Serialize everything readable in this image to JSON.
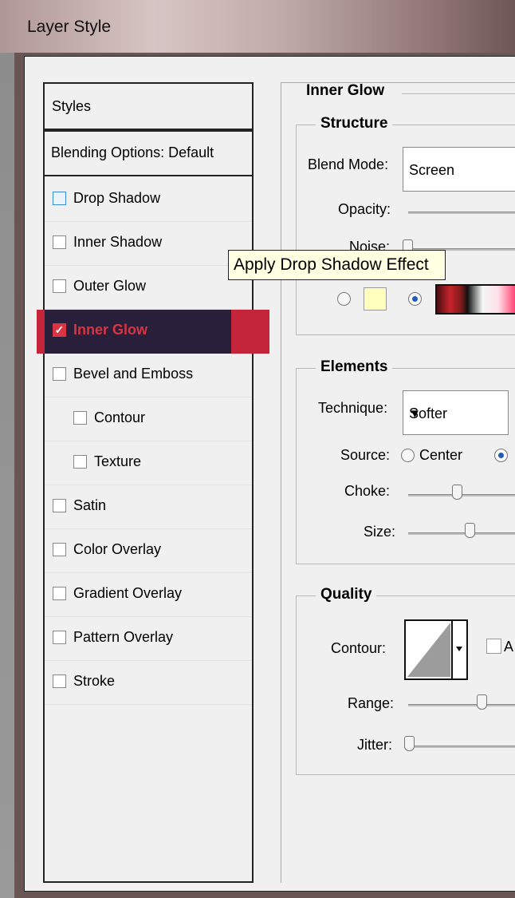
{
  "window": {
    "title": "Layer Style"
  },
  "styles_panel": {
    "header": "Styles",
    "blending_options": "Blending Options: Default",
    "items": [
      {
        "label": "Drop Shadow",
        "checked": false,
        "indent": false,
        "focused": true
      },
      {
        "label": "Inner Shadow",
        "checked": false,
        "indent": false
      },
      {
        "label": "Outer Glow",
        "checked": false,
        "indent": false
      },
      {
        "label": "Inner Glow",
        "checked": true,
        "indent": false,
        "active": true
      },
      {
        "label": "Bevel and Emboss",
        "checked": false,
        "indent": false
      },
      {
        "label": "Contour",
        "checked": false,
        "indent": true
      },
      {
        "label": "Texture",
        "checked": false,
        "indent": true
      },
      {
        "label": "Satin",
        "checked": false,
        "indent": false
      },
      {
        "label": "Color Overlay",
        "checked": false,
        "indent": false
      },
      {
        "label": "Gradient Overlay",
        "checked": false,
        "indent": false
      },
      {
        "label": "Pattern Overlay",
        "checked": false,
        "indent": false
      },
      {
        "label": "Stroke",
        "checked": false,
        "indent": false
      }
    ]
  },
  "inner_glow": {
    "title": "Inner Glow",
    "structure": {
      "title": "Structure",
      "blend_mode_label": "Blend Mode:",
      "blend_mode_value": "Screen",
      "opacity_label": "Opacity:",
      "noise_label": "Noise:",
      "color_selected": "gradient"
    },
    "elements": {
      "title": "Elements",
      "technique_label": "Technique:",
      "technique_value": "Softer",
      "source_label": "Source:",
      "source_center_label": "Center",
      "source_selected": "edge",
      "choke_label": "Choke:",
      "size_label": "Size:"
    },
    "quality": {
      "title": "Quality",
      "contour_label": "Contour:",
      "antialias_label": "A",
      "range_label": "Range:",
      "jitter_label": "Jitter:"
    }
  },
  "tooltip": {
    "text": "Apply Drop Shadow Effect"
  },
  "icons": {
    "dropdown": "▼",
    "checkmark": "✓"
  },
  "colors": {
    "active_item_bg": "#2a1f3a",
    "active_accent": "#c4253b",
    "glow_color": "#ffffbe"
  }
}
